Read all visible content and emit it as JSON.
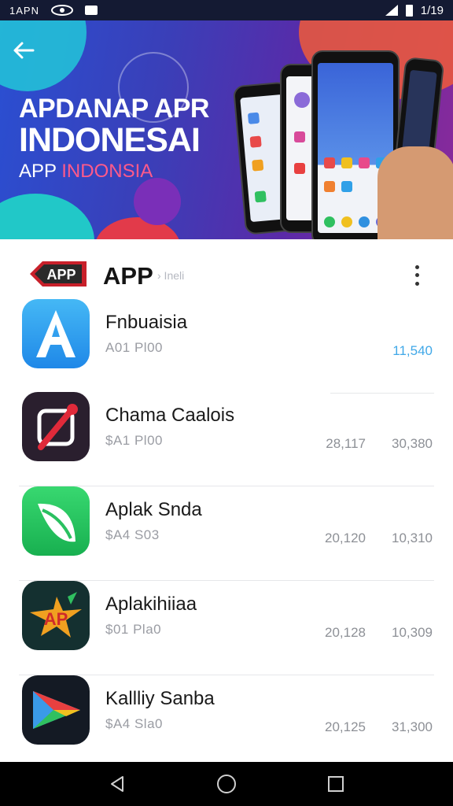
{
  "status_bar": {
    "left_text": "1APN",
    "time": "1/19",
    "icons": [
      "wifi-eye-icon",
      "notification-icon",
      "signal-icon",
      "battery-icon"
    ]
  },
  "banner": {
    "line1": "APDANAP APR",
    "line2": "INDONESAI",
    "line3_part1": "APP",
    "line3_part2": "INDONSIA",
    "back_icon": "arrow-left-icon"
  },
  "header": {
    "logo_text": "APP",
    "title": "APP",
    "subtitle": "› Ineli"
  },
  "apps": [
    {
      "name": "Fnbuaisia",
      "sub": "A01 Pl00",
      "stat1": "",
      "stat2": "11,540",
      "icon": "letter-a-icon"
    },
    {
      "name": "Chama Caalois",
      "sub": "$A1 Pl00",
      "stat1": "28,117",
      "stat2": "30,380",
      "icon": "camera-pen-icon"
    },
    {
      "name": "Aplak Snda",
      "sub": "$A4 S03",
      "stat1": "20,120",
      "stat2": "10,310",
      "icon": "leaf-icon"
    },
    {
      "name": "Aplakihiiaa",
      "sub": "$01 Pla0",
      "stat1": "20,128",
      "stat2": "10,309",
      "icon": "app-logo-icon"
    },
    {
      "name": "Kallliy Sanba",
      "sub": "$A4 Sla0",
      "stat1": "20,125",
      "stat2": "31,300",
      "icon": "play-triangle-icon"
    }
  ],
  "colors": {
    "accent_stat": "#41a8e8",
    "banner_start": "#2a4fd2",
    "banner_end": "#8a2a9a"
  },
  "nav": {
    "icons": [
      "back-triangle-icon",
      "home-circle-icon",
      "recents-square-icon"
    ]
  }
}
